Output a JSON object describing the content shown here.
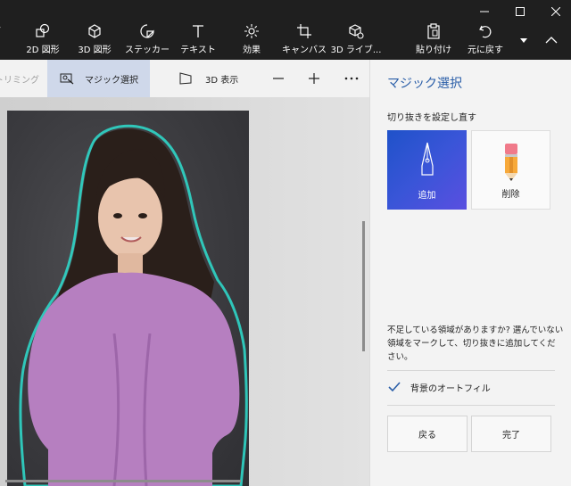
{
  "toolbar": {
    "items": [
      {
        "label": "2D 図形",
        "icon": "2d-shapes-icon"
      },
      {
        "label": "3D 図形",
        "icon": "3d-shapes-icon"
      },
      {
        "label": "ステッカー",
        "icon": "sticker-icon"
      },
      {
        "label": "テキスト",
        "icon": "text-icon"
      },
      {
        "label": "効果",
        "icon": "effects-icon"
      },
      {
        "label": "キャンバス",
        "icon": "canvas-icon"
      },
      {
        "label": "3D ライブ...",
        "icon": "3d-library-icon"
      },
      {
        "label": "貼り付け",
        "icon": "paste-icon"
      },
      {
        "label": "元に戻す",
        "icon": "undo-icon"
      }
    ]
  },
  "subtoolbar": {
    "trim_label": "トリミング",
    "magic_label": "マジック選択",
    "view3d_label": "3D 表示"
  },
  "panel": {
    "title": "マジック選択",
    "subtitle": "切り抜きを設定し直す",
    "add_label": "追加",
    "erase_label": "削除",
    "message": "不足している領域がありますか? 選んでいない領域をマークして、切り抜きに追加してください。",
    "autofill_label": "背景のオートフィル",
    "autofill_checked": true,
    "back_label": "戻る",
    "done_label": "完了"
  },
  "colors": {
    "accent": "#2a5ea8",
    "toolbar_bg": "#1f1f1f",
    "selection_outline": "#2fd6c8",
    "add_tile_start": "#1f52c9",
    "add_tile_end": "#5a4fe0"
  }
}
